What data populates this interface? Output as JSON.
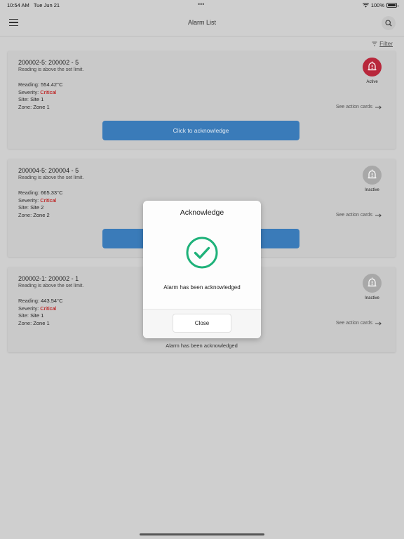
{
  "status_bar": {
    "time": "10:54 AM",
    "date": "Tue Jun 21",
    "battery": "100%",
    "dots": "•••"
  },
  "navbar": {
    "title": "Alarm List"
  },
  "filter_label": "Filter",
  "alarms": [
    {
      "title": "200002-5: 200002 - 5",
      "subtitle": "Reading is above the set limit.",
      "reading_label": "Reading:",
      "reading": "554.42°C",
      "severity_label": "Severity:",
      "severity": "Critical",
      "site_label": "Site:",
      "site": "Site 1",
      "zone_label": "Zone:",
      "zone": "Zone 1",
      "status": "Active",
      "action_link": "See action cards",
      "ack_button": "Click to acknowledge"
    },
    {
      "title": "200004-5: 200004 - 5",
      "subtitle": "Reading is above the set limit.",
      "reading_label": "Reading:",
      "reading": "665.33°C",
      "severity_label": "Severity:",
      "severity": "Critical",
      "site_label": "Site:",
      "site": "Site 2",
      "zone_label": "Zone:",
      "zone": "Zone 2",
      "status": "Inactive",
      "action_link": "See action cards"
    },
    {
      "title": "200002-1: 200002 - 1",
      "subtitle": "Reading is above the set limit.",
      "reading_label": "Reading:",
      "reading": "443.54°C",
      "severity_label": "Severity:",
      "severity": "Critical",
      "site_label": "Site:",
      "site": "Site 1",
      "zone_label": "Zone:",
      "zone": "Zone 1",
      "status": "Inactive",
      "action_link": "See action cards",
      "ack_text": "Alarm has been acknowledged"
    }
  ],
  "modal": {
    "title": "Acknowledge",
    "message": "Alarm has been acknowledged",
    "close_label": "Close"
  },
  "colors": {
    "active_alarm": "#b8273b",
    "inactive_alarm": "#a8a8a8",
    "primary_button": "#3a7bb9",
    "critical_text": "#b00000",
    "success_check": "#1fb27a"
  },
  "icons": {
    "menu": "hamburger-icon",
    "search": "search-icon",
    "filter": "filter-icon",
    "alarm": "bell-alert-icon",
    "arrow": "arrow-right-icon",
    "success": "check-circle-icon"
  }
}
